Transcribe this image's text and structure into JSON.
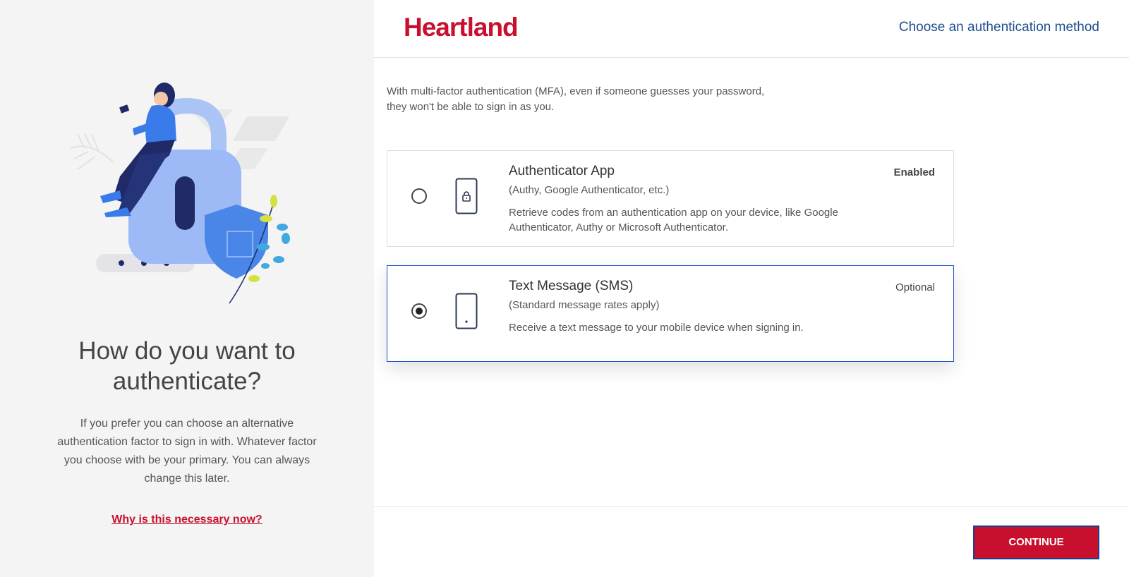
{
  "brand": {
    "name": "Heartland",
    "color": "#c8102e"
  },
  "header": {
    "title": "Choose an authentication method"
  },
  "left_panel": {
    "title": "How do you want to authenticate?",
    "description": "If you prefer you can choose an alternative authentication factor to sign in with. Whatever factor you choose with be your primary. You can always change this later.",
    "link": "Why is this necessary now?"
  },
  "intro": {
    "line1": "With multi-factor authentication (MFA), even if someone guesses your password,",
    "line2": "they won't be able to sign in as you."
  },
  "options": [
    {
      "title": "Authenticator App",
      "subtitle": "(Authy, Google Authenticator, etc.)",
      "description": "Retrieve codes from an authentication app on your device, like Google Authenticator, Authy or Microsoft Authenticator.",
      "status": "Enabled",
      "selected": false,
      "icon": "phone-lock-icon"
    },
    {
      "title": "Text Message (SMS)",
      "subtitle": "(Standard message rates apply)",
      "description": "Receive a text message to your mobile device when signing in.",
      "status": "Optional",
      "selected": true,
      "icon": "mobile-phone-icon"
    }
  ],
  "footer": {
    "continue_label": "CONTINUE"
  },
  "colors": {
    "accent_red": "#c8102e",
    "selected_border": "#1e56c8",
    "header_title": "#1f4e8c"
  }
}
